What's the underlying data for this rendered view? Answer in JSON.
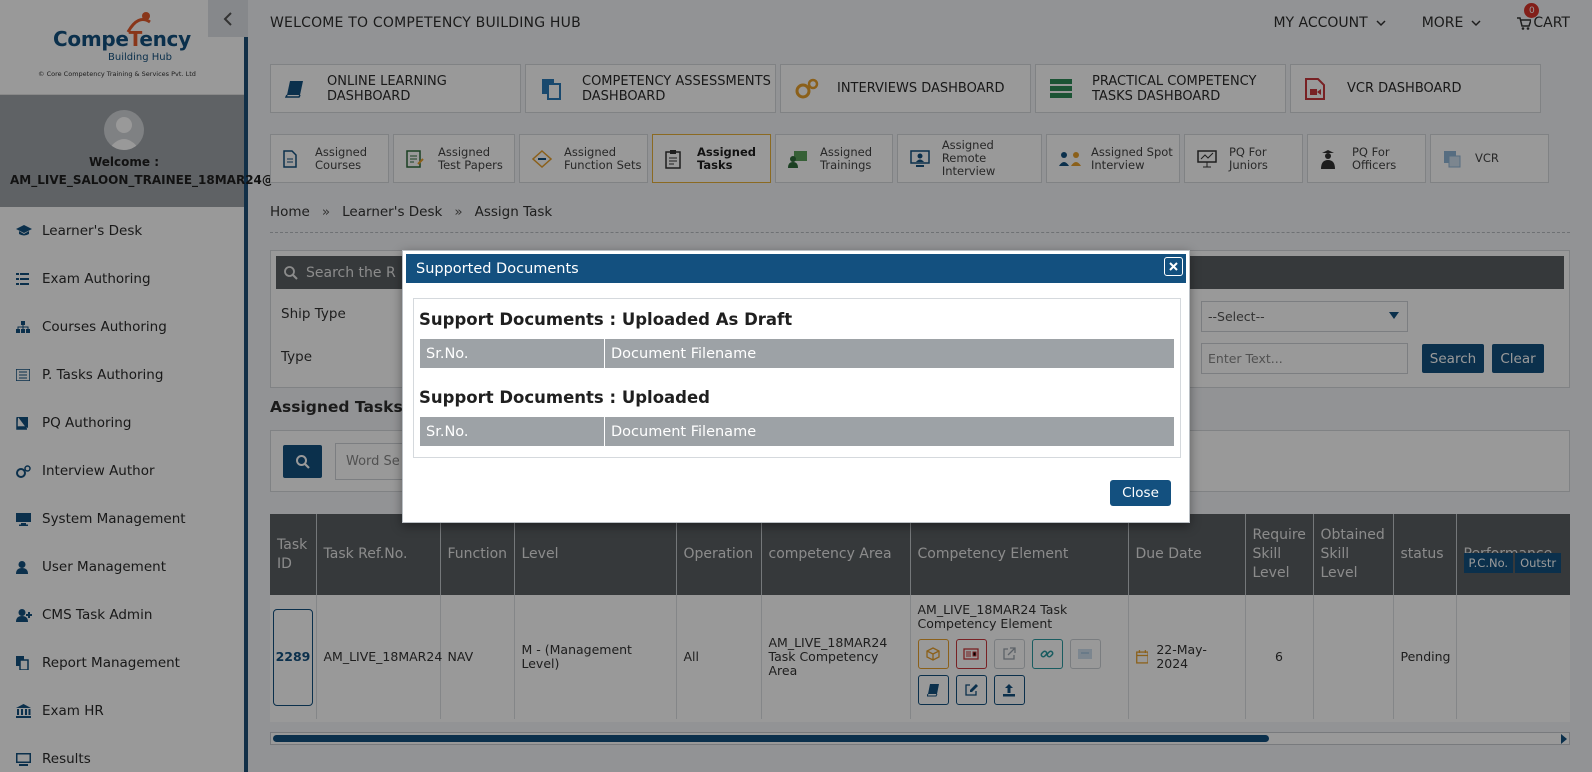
{
  "brand": {
    "name_part1": "Compe",
    "name_part2": "T",
    "name_part3": "ency",
    "sub": "Building Hub",
    "copyright": "© Core Competency Training & Services Pvt. Ltd"
  },
  "profile": {
    "welcome": "Welcome :",
    "username": "AM_LIVE_SALOON_TRAINEE_18MAR24@"
  },
  "sidebar": {
    "items": [
      {
        "label": "Learner's Desk",
        "icon": "graduation-cap-icon"
      },
      {
        "label": "Exam Authoring",
        "icon": "list-icon"
      },
      {
        "label": "Courses Authoring",
        "icon": "sitemap-icon"
      },
      {
        "label": "P. Tasks Authoring",
        "icon": "tasks-icon"
      },
      {
        "label": "PQ Authoring",
        "icon": "book-icon"
      },
      {
        "label": "Interview Author",
        "icon": "gears-icon"
      },
      {
        "label": "System Management",
        "icon": "desktop-icon"
      },
      {
        "label": "User Management",
        "icon": "user-icon"
      },
      {
        "label": "CMS Task Admin",
        "icon": "user-plus-icon"
      },
      {
        "label": "Report Management",
        "icon": "copy-icon"
      },
      {
        "label": "Exam HR",
        "icon": "bank-icon"
      },
      {
        "label": "Results",
        "icon": "monitor-icon"
      }
    ]
  },
  "topbar": {
    "title": "WELCOME TO COMPETENCY BUILDING HUB",
    "my_account": "MY ACCOUNT",
    "more": "MORE",
    "cart": "CART",
    "cart_count": "0"
  },
  "dashboards": [
    {
      "line1": "ONLINE LEARNING",
      "line2": "DASHBOARD",
      "icon": "book-icon"
    },
    {
      "line1": "COMPETENCY ASSESSMENTS",
      "line2": "DASHBOARD",
      "icon": "documents-icon"
    },
    {
      "line1": "INTERVIEWS DASHBOARD",
      "line2": "",
      "icon": "gears-icon"
    },
    {
      "line1": "PRACTICAL COMPETENCY",
      "line2": "TASKS DASHBOARD",
      "icon": "server-icon"
    },
    {
      "line1": "VCR DASHBOARD",
      "line2": "",
      "icon": "video-file-icon"
    }
  ],
  "tabs": [
    {
      "line1": "Assigned",
      "line2": "Courses",
      "icon": "document-icon"
    },
    {
      "line1": "Assigned",
      "line2": "Test Papers",
      "icon": "test-paper-icon"
    },
    {
      "line1": "Assigned",
      "line2": "Function Sets",
      "icon": "function-set-icon"
    },
    {
      "line1": "Assigned",
      "line2": "Tasks",
      "icon": "clipboard-icon",
      "active": true
    },
    {
      "line1": "Assigned",
      "line2": "Trainings",
      "icon": "training-icon"
    },
    {
      "line1": "Assigned Remote",
      "line2": "Interview",
      "icon": "remote-interview-icon"
    },
    {
      "line1": "Assigned Spot",
      "line2": "Interview",
      "icon": "spot-interview-icon"
    },
    {
      "line1": "PQ For",
      "line2": "Juniors",
      "icon": "presentation-icon"
    },
    {
      "line1": "PQ For",
      "line2": "Officers",
      "icon": "officer-icon"
    },
    {
      "line1": "VCR",
      "line2": "",
      "icon": "vcr-icon"
    }
  ],
  "breadcrumb": {
    "home": "Home",
    "learners_desk": "Learner's Desk",
    "current": "Assign Task",
    "separator": "»"
  },
  "filter": {
    "search_placeholder": "Search the R",
    "ship_type_label": "Ship Type",
    "type_label": "Type",
    "select_value": "--Select--",
    "text_placeholder": "Enter Text...",
    "search_button": "Search",
    "clear_button": "Clear"
  },
  "assigned_tasks": {
    "title": "Assigned Tasks",
    "word_search_placeholder": "Word Se"
  },
  "table": {
    "headers": [
      "Task ID",
      "Task Ref.No.",
      "Function",
      "Level",
      "Operation",
      "competency Area",
      "Competency Element",
      "Due Date",
      "Require Skill Level",
      "Obtained Skill Level",
      "status",
      "Performance"
    ],
    "row": {
      "task_id": "2289",
      "ref_no": "AM_LIVE_18MAR24",
      "function": "NAV",
      "level": "M - (Management Level)",
      "operation": "All",
      "competency_area": "AM_LIVE_18MAR24 Task Competency Area",
      "competency_element": "AM_LIVE_18MAR24 Task Competency Element",
      "due_date": "22-May-2024",
      "require_skill": "6",
      "obtained_skill": "",
      "status": "Pending",
      "perf_tag1": "P.C.No.",
      "perf_tag2": "Outstr"
    }
  },
  "modal": {
    "title": "Supported Documents",
    "draft_title": "Support Documents : Uploaded As Draft",
    "uploaded_title": "Support Documents : Uploaded",
    "col_srno": "Sr.No.",
    "col_filename": "Document Filename",
    "close_button": "Close"
  },
  "colors": {
    "primary": "#13507f",
    "header_gray": "#5a5f63",
    "active_tab_border": "#e8b13a",
    "brand_orange": "#e45b2c",
    "badge_red": "#d9342b"
  }
}
